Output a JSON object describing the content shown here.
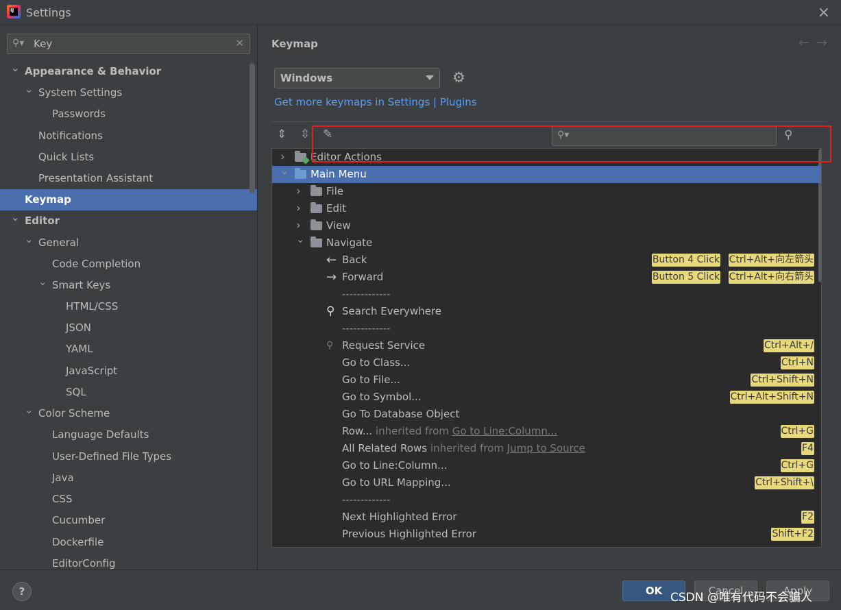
{
  "window": {
    "title": "Settings",
    "close_icon": "×"
  },
  "sidebar": {
    "search_value": "Key",
    "tree": [
      {
        "label": "Appearance & Behavior",
        "expanded": true,
        "bold": true
      },
      {
        "label": "System Settings",
        "expanded": true
      },
      {
        "label": "Passwords"
      },
      {
        "label": "Notifications"
      },
      {
        "label": "Quick Lists"
      },
      {
        "label": "Presentation Assistant"
      },
      {
        "label": "Keymap",
        "selected": true,
        "bold": true
      },
      {
        "label": "Editor",
        "expanded": true,
        "bold": true
      },
      {
        "label": "General",
        "expanded": true
      },
      {
        "label": "Code Completion"
      },
      {
        "label": "Smart Keys",
        "expanded": true
      },
      {
        "label": "HTML/CSS"
      },
      {
        "label": "JSON"
      },
      {
        "label": "YAML"
      },
      {
        "label": "JavaScript"
      },
      {
        "label": "SQL"
      },
      {
        "label": "Color Scheme",
        "expanded": true
      },
      {
        "label": "Language Defaults"
      },
      {
        "label": "User-Defined File Types"
      },
      {
        "label": "Java"
      },
      {
        "label": "CSS"
      },
      {
        "label": "Cucumber"
      },
      {
        "label": "Dockerfile"
      },
      {
        "label": "EditorConfig"
      }
    ]
  },
  "keymap": {
    "title": "Keymap",
    "selected_keymap": "Windows",
    "get_more_link": "Get more keymaps in Settings | Plugins",
    "filter_placeholder": ""
  },
  "actions": [
    {
      "label": "Editor Actions",
      "icon": "folder-green",
      "arrow": "right"
    },
    {
      "label": "Main Menu",
      "icon": "folder-blue",
      "arrow": "down",
      "selected": true
    },
    {
      "label": "File",
      "icon": "folder",
      "arrow": "right"
    },
    {
      "label": "Edit",
      "icon": "folder",
      "arrow": "right"
    },
    {
      "label": "View",
      "icon": "folder",
      "arrow": "right"
    },
    {
      "label": "Navigate",
      "icon": "folder",
      "arrow": "down"
    },
    {
      "label": "Back",
      "icon": "arrow-left",
      "shortcuts": [
        "Ctrl+Alt+向左箭头",
        "Button 4 Click"
      ]
    },
    {
      "label": "Forward",
      "icon": "arrow-right",
      "shortcuts": [
        "Ctrl+Alt+向右箭头",
        "Button 5 Click"
      ]
    },
    {
      "label": "-------------",
      "separator": true
    },
    {
      "label": "Search Everywhere",
      "icon": "search"
    },
    {
      "label": "-------------",
      "separator": true
    },
    {
      "label": "Request Service",
      "icon": "search-small",
      "shortcuts": [
        "Ctrl+Alt+/"
      ]
    },
    {
      "label": "Go to Class...",
      "shortcuts": [
        "Ctrl+N"
      ]
    },
    {
      "label": "Go to File...",
      "shortcuts": [
        "Ctrl+Shift+N"
      ]
    },
    {
      "label": "Go to Symbol...",
      "shortcuts": [
        "Ctrl+Alt+Shift+N"
      ]
    },
    {
      "label": "Go To Database Object"
    },
    {
      "label": "Row...",
      "inherited_text": "inherited from",
      "inherited_link": "Go to Line:Column...",
      "shortcuts": [
        "Ctrl+G"
      ]
    },
    {
      "label": "All Related Rows",
      "inherited_text": "inherited from",
      "inherited_link": "Jump to Source",
      "shortcuts": [
        "F4"
      ]
    },
    {
      "label": "Go to Line:Column...",
      "shortcuts": [
        "Ctrl+G"
      ]
    },
    {
      "label": "Go to URL Mapping...",
      "shortcuts": [
        "Ctrl+Shift+\\"
      ]
    },
    {
      "label": "-------------",
      "separator": true
    },
    {
      "label": "Next Highlighted Error",
      "shortcuts": [
        "F2"
      ]
    },
    {
      "label": "Previous Highlighted Error",
      "shortcuts": [
        "Shift+F2"
      ]
    }
  ],
  "buttons": {
    "ok": "OK",
    "cancel": "Cancel",
    "apply": "Apply",
    "help": "?"
  },
  "watermark": "CSDN @唯有代码不会骗人",
  "colors": {
    "selection": "#4b6eaf",
    "shortcut_bg": "#e7d87a",
    "link": "#589df6",
    "highlight_box": "#e02020"
  }
}
